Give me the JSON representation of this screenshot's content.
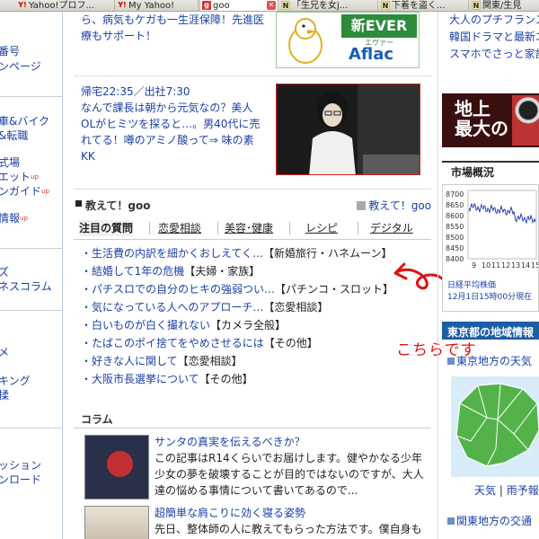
{
  "tabs": [
    {
      "label": "Yahoo!プロフ...",
      "icon": "yahoo-icon"
    },
    {
      "label": "My Yahoo!",
      "icon": "yahoo-icon"
    },
    {
      "label": "goo",
      "icon": "goo-icon",
      "active": true
    },
    {
      "label": "「生兄を女j...",
      "icon": "page-icon"
    },
    {
      "label": "下着を盗く...",
      "icon": "page-icon"
    },
    {
      "label": "関東/生見",
      "icon": "page-icon"
    }
  ],
  "left_nav": {
    "items": [
      "番号",
      "ンページ",
      "車&バイク",
      "&転職",
      "式場",
      "エット",
      "ンガイド",
      "情報",
      "ズ",
      "ネスコラム",
      "メ",
      "キング",
      "揉",
      "ッション",
      "ンロード"
    ],
    "up_badge": "up"
  },
  "main": {
    "ad_text": "ら、病気もケガも一生涯保障！先進医療もサポート！",
    "afac": {
      "ever": "新EVER",
      "ever_sub": "エヴァー",
      "logo": "Aflac"
    },
    "kk": {
      "time": "帰宅22:35／出社7:30",
      "body": "なんで課長は朝から元気なの？美人OLがヒミツを探ると…。男40代に売れてる！噂のアミノ酸って⇒ 味の素KK"
    },
    "oshiete": {
      "title": "教えて！goo",
      "link": "教えて！goo",
      "tabs": [
        "注目の質問",
        "恋愛相談",
        "美容･健康",
        "レシピ",
        "デジタル"
      ],
      "questions": [
        {
          "q": "・生活費の内訳を細かくおしえてく…",
          "cat": "【新婚旅行・ハネムーン】"
        },
        {
          "q": "・結婚して1年の危機",
          "cat": "【夫婦・家族】"
        },
        {
          "q": "・パチスロでの自分のヒキの強弱つい…",
          "cat": "【パチンコ・スロット】"
        },
        {
          "q": "・気になっている人へのアプローチ…",
          "cat": "【恋愛相談】"
        },
        {
          "q": "・白いものが白く撮れない",
          "cat": "【カメラ全般】"
        },
        {
          "q": "・たばこのポイ捨てをやめさせるには",
          "cat": "【その他】"
        },
        {
          "q": "・好きな人に関して",
          "cat": "【恋愛相談】"
        },
        {
          "q": "・大阪市長選挙について",
          "cat": "【その他】"
        }
      ]
    },
    "annotation": "こちらです",
    "column": {
      "title": "コラム",
      "items": [
        {
          "title": "サンタの真実を伝えるべきか？",
          "desc": "この記事はR14くらいでお届けします。健やかなる少年少女の夢を破壊することが目的ではないのですが、大人達の悩める事情について書いてあるので..."
        },
        {
          "title": "超簡単な肩こりに効く寝る姿勢",
          "desc": "先日、整体師の人に教えてもらった方法です。僕自身も"
        }
      ]
    }
  },
  "right": {
    "links": [
      "大人のプチフランス",
      "韓国ドラマと最新エ",
      "スマホでさっと家計"
    ],
    "banner": {
      "line1": "地上",
      "line2": "最大の"
    },
    "market": {
      "title": "市場概況",
      "caption1": "日経平均株価",
      "caption2": "12月1日15時00分現在",
      "yticks": [
        "8700",
        "8650",
        "8600",
        "8550",
        "8500",
        "8450",
        "8400"
      ],
      "xticks": [
        "9",
        "10",
        "11",
        "12",
        "13",
        "14",
        "15"
      ]
    },
    "weather": {
      "title": "東京都の地域情報",
      "sub": "東京地方の天気",
      "link1": "天気",
      "link2": "雨予報",
      "sub2": "関東地方の交通"
    }
  },
  "colors": {
    "link": "#1a3fa8",
    "annotation": "#e01010",
    "weather_header": "#1b5ea6",
    "ad_frame": "#cc2222"
  }
}
